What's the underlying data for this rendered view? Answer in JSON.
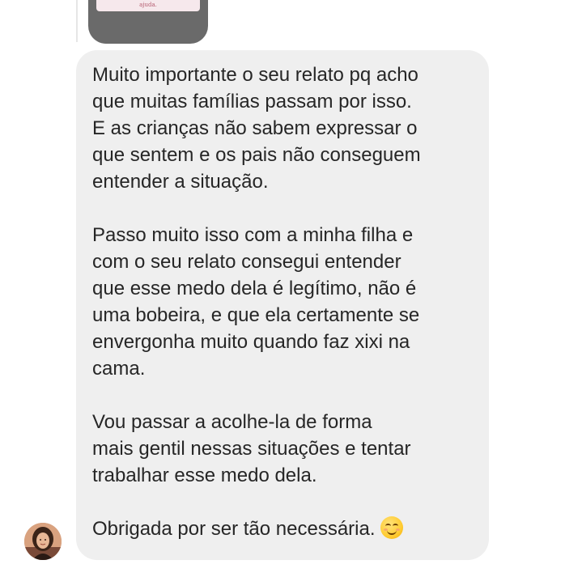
{
  "quoted_message": {
    "visible_text": "ajuda."
  },
  "message": {
    "paragraphs": [
      "Muito importante o seu relato pq acho\nque muitas famílias passam por isso.\nE as crianças não sabem expressar o\nque sentem e os pais não conseguem\nentender a situação.",
      "Passo muito isso com a minha filha e\ncom o seu relato consegui entender\nque esse medo dela é legítimo, não é\numa bobeira, e que ela certamente se\nenvergonha muito quando faz xixi na\ncama.",
      "Vou passar a acolhe-la de forma\nmais gentil nessas situações e tentar\ntrabalhar esse medo dela."
    ],
    "closing": "Obrigada por ser tão necessária.",
    "closing_emoji": "smiling-face-with-smiling-eyes-emoji"
  },
  "sender": {
    "avatar": "sender-profile-photo"
  },
  "colors": {
    "bubble_background": "#efefef",
    "text": "#262626",
    "quoted_card_background": "#6a6a6a"
  }
}
